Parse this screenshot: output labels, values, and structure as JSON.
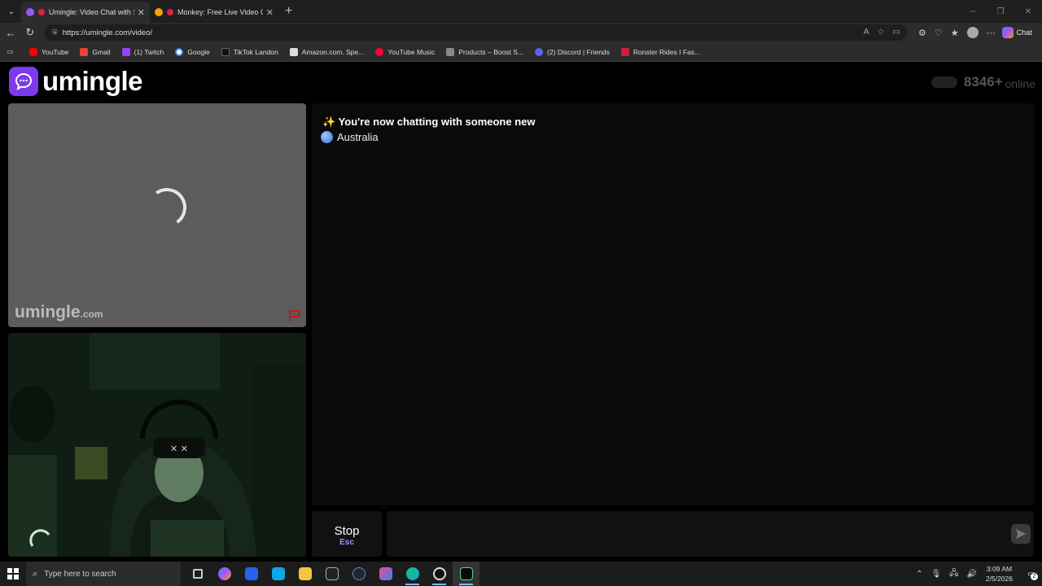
{
  "browser": {
    "tabs": [
      {
        "title": "Umingle: Video Chat with Stra",
        "active": true,
        "favicon_color": "#8b5cf6"
      },
      {
        "title": "Monkey: Free Live Video Chat",
        "active": false,
        "favicon_color": "#f59e0b"
      }
    ],
    "url": "https://umingle.com/video/",
    "chat_label": "Chat",
    "bookmarks": [
      {
        "label": "YouTube",
        "color": "#ff0000"
      },
      {
        "label": "Gmail",
        "color": "#ea4335"
      },
      {
        "label": "(1) Twitch",
        "color": "#9146ff"
      },
      {
        "label": "Google",
        "color": "#4285f4"
      },
      {
        "label": "TikTok Landon",
        "color": "#222222"
      },
      {
        "label": "Amazon.com. Spe...",
        "color": "#dddddd"
      },
      {
        "label": "YouTube Music",
        "color": "#ff0033"
      },
      {
        "label": "Products – Boost S...",
        "color": "#888888"
      },
      {
        "label": "(2) Discord | Friends",
        "color": "#5865f2"
      },
      {
        "label": "Ronster Rides I Fas...",
        "color": "#cc2233"
      }
    ]
  },
  "site": {
    "logo_text": "umingle",
    "online_count": "8346+",
    "online_label": "online",
    "watermark": "umingle",
    "watermark_suffix": ".com",
    "accent_color": "#7c3aed"
  },
  "chat": {
    "system_message": "✨ You're now chatting with someone new",
    "country": "Australia"
  },
  "controls": {
    "stop_label": "Stop",
    "stop_key": "Esc",
    "message_placeholder": ""
  },
  "taskbar": {
    "search_placeholder": "Type here to search",
    "time": "3:09 AM",
    "date": "2/5/2026",
    "notification_count": "2"
  }
}
